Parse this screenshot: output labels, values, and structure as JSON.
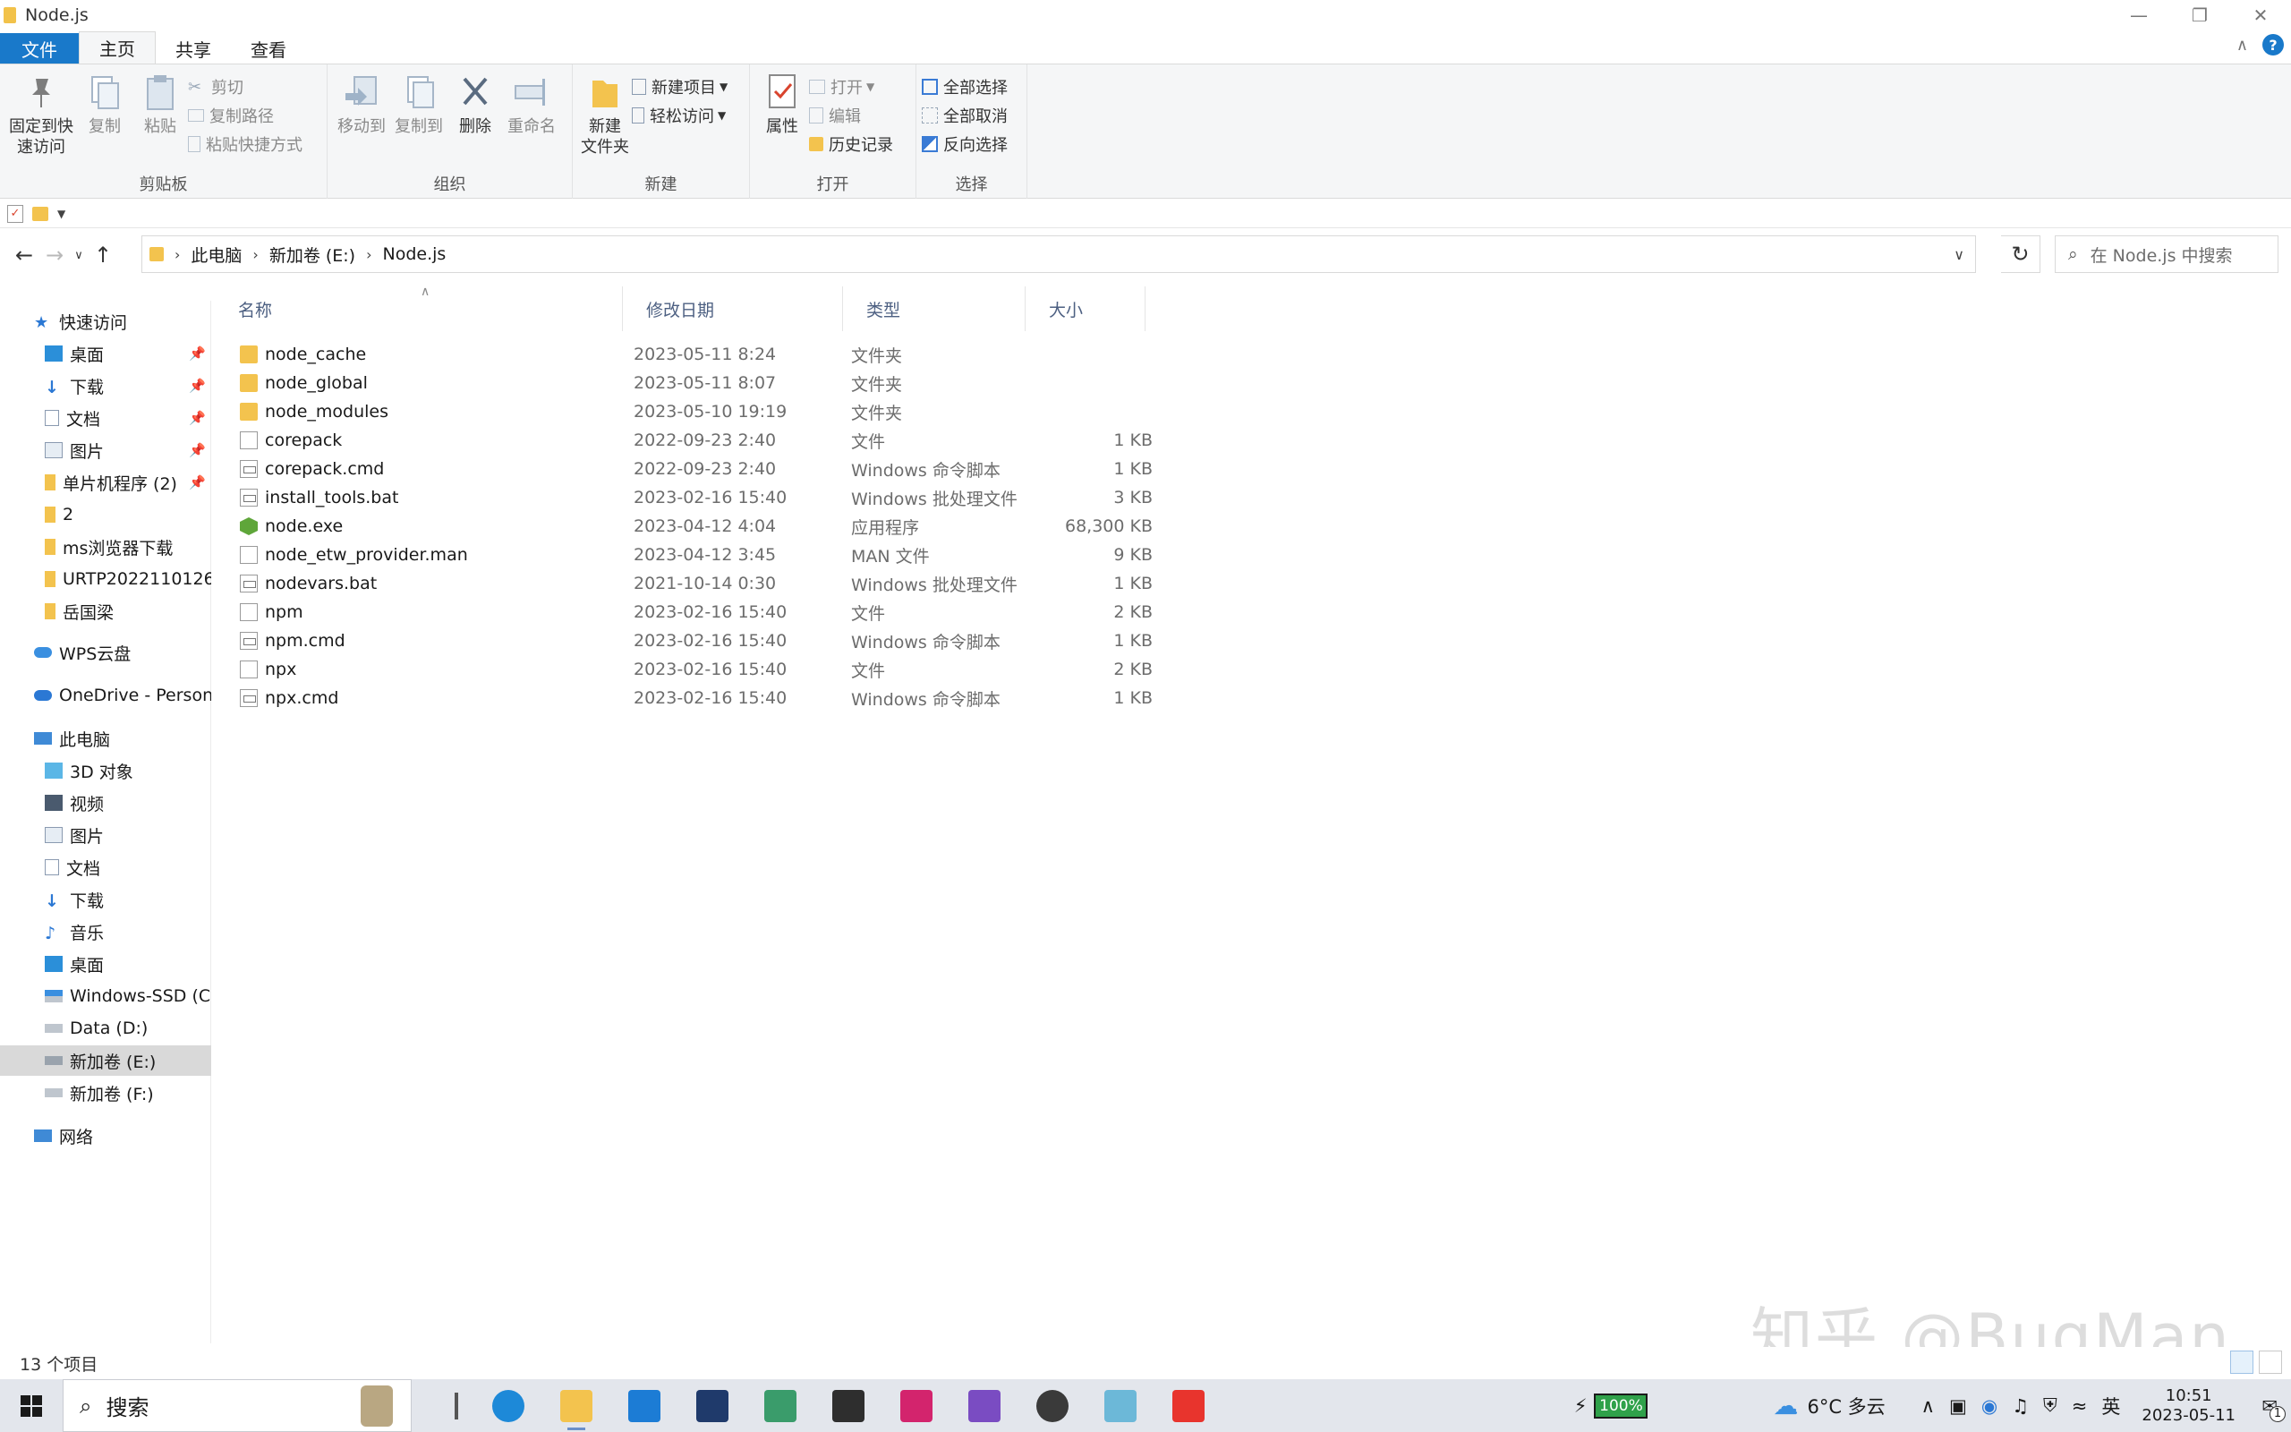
{
  "window": {
    "title": "Node.js"
  },
  "ribbon_tabs": [
    "文件",
    "主页",
    "共享",
    "查看"
  ],
  "ribbon": {
    "clipboard": {
      "pin_label_1": "固定到快",
      "pin_label_2": "速访问",
      "copy": "复制",
      "paste": "粘贴",
      "cut": "剪切",
      "copy_path": "复制路径",
      "paste_shortcut": "粘贴快捷方式",
      "group": "剪贴板"
    },
    "organize": {
      "move_to": "移动到",
      "copy_to": "复制到",
      "delete": "删除",
      "rename": "重命名",
      "group": "组织"
    },
    "new": {
      "new_folder_1": "新建",
      "new_folder_2": "文件夹",
      "new_item": "新建项目",
      "easy_access": "轻松访问",
      "group": "新建"
    },
    "open": {
      "properties": "属性",
      "open": "打开",
      "edit": "编辑",
      "history": "历史记录",
      "group": "打开"
    },
    "select": {
      "select_all": "全部选择",
      "select_none": "全部取消",
      "invert": "反向选择",
      "group": "选择"
    }
  },
  "address": {
    "crumbs": [
      "此电脑",
      "新加卷 (E:)",
      "Node.js"
    ],
    "search_placeholder": "在 Node.js 中搜索"
  },
  "sidebar": {
    "quick_access": "快速访问",
    "quick_items": [
      "桌面",
      "下载",
      "文档",
      "图片",
      "单片机程序 (2)",
      "2",
      "ms浏览器下载",
      "URTP2022110126",
      "岳国梁"
    ],
    "wps": "WPS云盘",
    "onedrive": "OneDrive - Personal",
    "this_pc": "此电脑",
    "pc_items": [
      "3D 对象",
      "视频",
      "图片",
      "文档",
      "下载",
      "音乐",
      "桌面",
      "Windows-SSD (C:)",
      "Data (D:)",
      "新加卷 (E:)",
      "新加卷 (F:)"
    ],
    "network": "网络"
  },
  "columns": {
    "name": "名称",
    "date": "修改日期",
    "type": "类型",
    "size": "大小"
  },
  "files": [
    {
      "name": "node_cache",
      "date": "2023-05-11 8:24",
      "type": "文件夹",
      "size": "",
      "icon": "folder"
    },
    {
      "name": "node_global",
      "date": "2023-05-11 8:07",
      "type": "文件夹",
      "size": "",
      "icon": "folder"
    },
    {
      "name": "node_modules",
      "date": "2023-05-10 19:19",
      "type": "文件夹",
      "size": "",
      "icon": "folder"
    },
    {
      "name": "corepack",
      "date": "2022-09-23 2:40",
      "type": "文件",
      "size": "1 KB",
      "icon": "file"
    },
    {
      "name": "corepack.cmd",
      "date": "2022-09-23 2:40",
      "type": "Windows 命令脚本",
      "size": "1 KB",
      "icon": "cmd"
    },
    {
      "name": "install_tools.bat",
      "date": "2023-02-16 15:40",
      "type": "Windows 批处理文件",
      "size": "3 KB",
      "icon": "cmd"
    },
    {
      "name": "node.exe",
      "date": "2023-04-12 4:04",
      "type": "应用程序",
      "size": "68,300 KB",
      "icon": "exe"
    },
    {
      "name": "node_etw_provider.man",
      "date": "2023-04-12 3:45",
      "type": "MAN 文件",
      "size": "9 KB",
      "icon": "file"
    },
    {
      "name": "nodevars.bat",
      "date": "2021-10-14 0:30",
      "type": "Windows 批处理文件",
      "size": "1 KB",
      "icon": "cmd"
    },
    {
      "name": "npm",
      "date": "2023-02-16 15:40",
      "type": "文件",
      "size": "2 KB",
      "icon": "file"
    },
    {
      "name": "npm.cmd",
      "date": "2023-02-16 15:40",
      "type": "Windows 命令脚本",
      "size": "1 KB",
      "icon": "cmd"
    },
    {
      "name": "npx",
      "date": "2023-02-16 15:40",
      "type": "文件",
      "size": "2 KB",
      "icon": "file"
    },
    {
      "name": "npx.cmd",
      "date": "2023-02-16 15:40",
      "type": "Windows 命令脚本",
      "size": "1 KB",
      "icon": "cmd"
    }
  ],
  "status": {
    "item_count": "13 个项目"
  },
  "watermark": "知乎 @BugMan",
  "taskbar": {
    "search": "搜索",
    "battery": "100%",
    "weather": "6°C 多云",
    "ime": "英",
    "time": "10:51",
    "date": "2023-05-11",
    "notifications": "1"
  }
}
